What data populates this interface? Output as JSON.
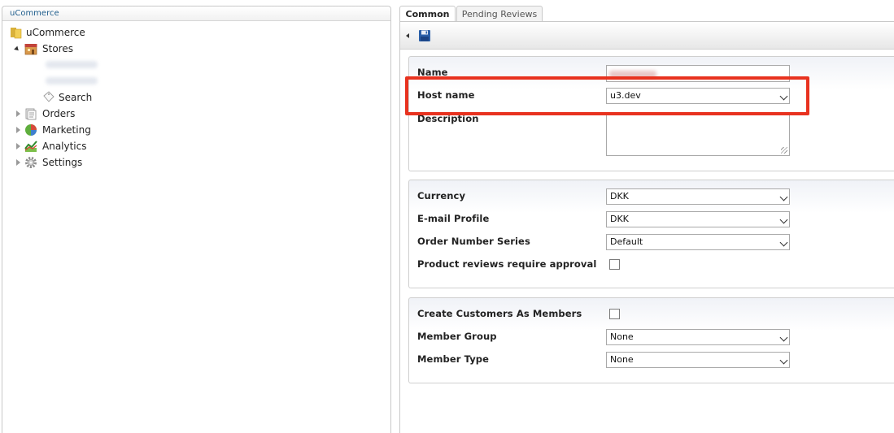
{
  "tree": {
    "header": "uCommerce",
    "root": "uCommerce",
    "stores": "Stores",
    "search": "Search",
    "orders": "Orders",
    "marketing": "Marketing",
    "analytics": "Analytics",
    "settings": "Settings"
  },
  "tabs": {
    "common": "Common",
    "pending_reviews": "Pending Reviews"
  },
  "general": {
    "name_label": "Name",
    "host_name_label": "Host name",
    "host_name_value": "u3.dev",
    "description_label": "Description"
  },
  "settings_section": {
    "currency_label": "Currency",
    "currency_value": "DKK",
    "email_profile_label": "E-mail Profile",
    "email_profile_value": "DKK",
    "order_number_series_label": "Order Number Series",
    "order_number_series_value": "Default",
    "product_reviews_label": "Product reviews require approval"
  },
  "members_section": {
    "create_customers_label": "Create Customers As Members",
    "member_group_label": "Member Group",
    "member_group_value": "None",
    "member_type_label": "Member Type",
    "member_type_value": "None"
  },
  "colors": {
    "highlight": "#e8321f",
    "link_blue": "#1e5d8c"
  }
}
